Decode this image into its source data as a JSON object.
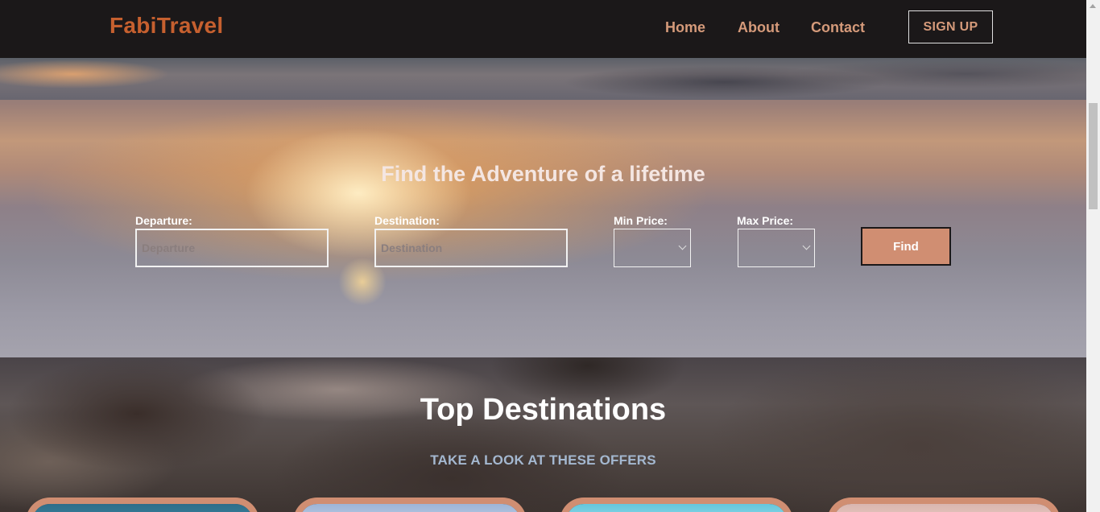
{
  "nav": {
    "brand": "FabiTravel",
    "links": [
      "Home",
      "About",
      "Contact"
    ],
    "signup_label": "SIGN UP"
  },
  "hero": {
    "title": "Find the Adventure of a lifetime",
    "fields": {
      "departure_label": "Departure:",
      "departure_placeholder": "Departure",
      "destination_label": "Destination:",
      "destination_placeholder": "Destination",
      "min_price_label": "Min Price:",
      "max_price_label": "Max Price:"
    },
    "find_label": "Find"
  },
  "destinations": {
    "title": "Top Destinations",
    "subtitle": "TAKE A LOOK AT THESE OFFERS"
  },
  "colors": {
    "brand": "#c6602f",
    "nav_text": "#d59a7a",
    "accent": "#d08e72",
    "nav_bg": "#1b1819"
  },
  "icons": {
    "select_arrow": "chevron-down-icon",
    "scroll_up": "arrow-up-icon"
  }
}
